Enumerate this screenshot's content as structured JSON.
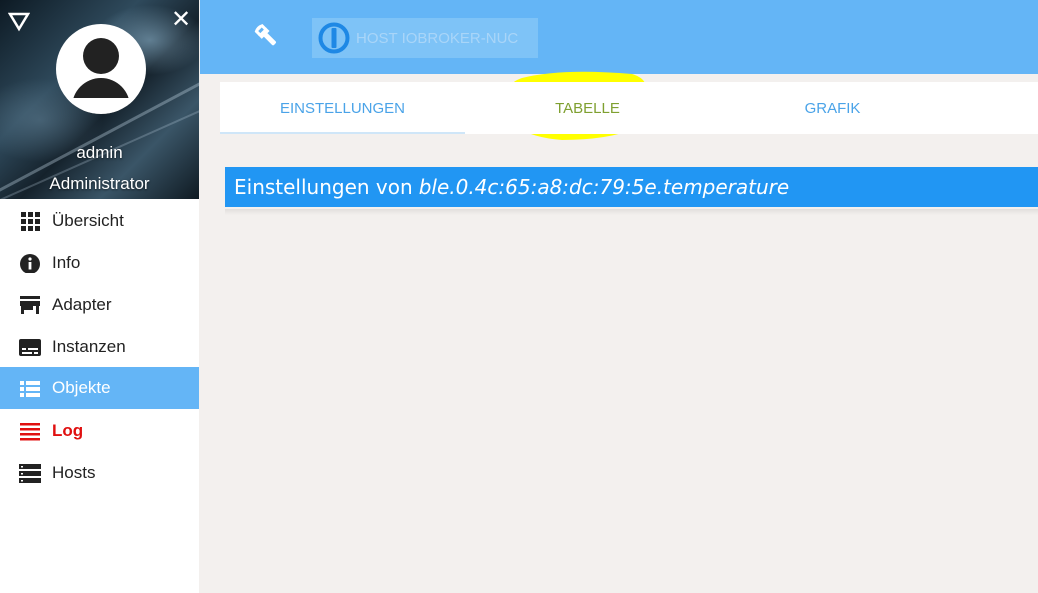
{
  "sidebar": {
    "user": {
      "name": "admin",
      "role": "Administrator"
    },
    "items": [
      {
        "label": "Übersicht",
        "icon": "apps-grid-icon"
      },
      {
        "label": "Info",
        "icon": "info-icon"
      },
      {
        "label": "Adapter",
        "icon": "store-icon"
      },
      {
        "label": "Instanzen",
        "icon": "subtitles-icon"
      },
      {
        "label": "Objekte",
        "icon": "list-icon",
        "active": true
      },
      {
        "label": "Log",
        "icon": "lines-icon",
        "color": "#e01010"
      },
      {
        "label": "Hosts",
        "icon": "storage-icon"
      }
    ]
  },
  "header": {
    "close_glyph": "✕",
    "host_label": "HOST IOBROKER-NUC"
  },
  "tabs": [
    {
      "label": "EINSTELLUNGEN",
      "active": true
    },
    {
      "label": "TABELLE"
    },
    {
      "label": "GRAFIK"
    }
  ],
  "section": {
    "prefix": "Einstellungen von",
    "object_id": "ble.0.4c:65:a8:dc:79:5e.temperature"
  },
  "colors": {
    "topbar": "#64b5f6",
    "section_header": "#2196f3",
    "active_nav": "#64b5f6",
    "log_red": "#e01010",
    "highlight": "#ffff00"
  }
}
